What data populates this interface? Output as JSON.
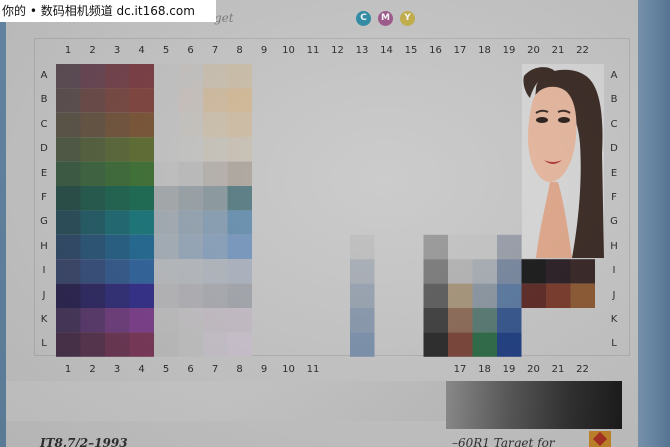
{
  "watermark": "你的 • 数码相机频道 dc.it168.com",
  "top_title": "Target",
  "cmy": [
    {
      "letter": "C",
      "color": "#2f8fa8"
    },
    {
      "letter": "M",
      "color": "#a15a8e"
    },
    {
      "letter": "Y",
      "color": "#c7b24a"
    }
  ],
  "columns": [
    "1",
    "2",
    "3",
    "4",
    "5",
    "6",
    "7",
    "8",
    "9",
    "10",
    "11",
    "12",
    "13",
    "14",
    "15",
    "16",
    "17",
    "18",
    "19",
    "20",
    "21",
    "22"
  ],
  "bottom_columns": [
    "1",
    "2",
    "3",
    "4",
    "5",
    "6",
    "7",
    "8",
    "9",
    "10",
    "11",
    "17",
    "18",
    "19",
    "20",
    "21",
    "22"
  ],
  "rows": [
    "A",
    "B",
    "C",
    "D",
    "E",
    "F",
    "G",
    "H",
    "I",
    "J",
    "K",
    "L"
  ],
  "bottom_left_caption": "IT8.7/2–1993",
  "bottom_right_caption": "–60R1 Target for",
  "colors": {
    "frame": "#5f7f9d",
    "card": "#c9c9c9"
  }
}
